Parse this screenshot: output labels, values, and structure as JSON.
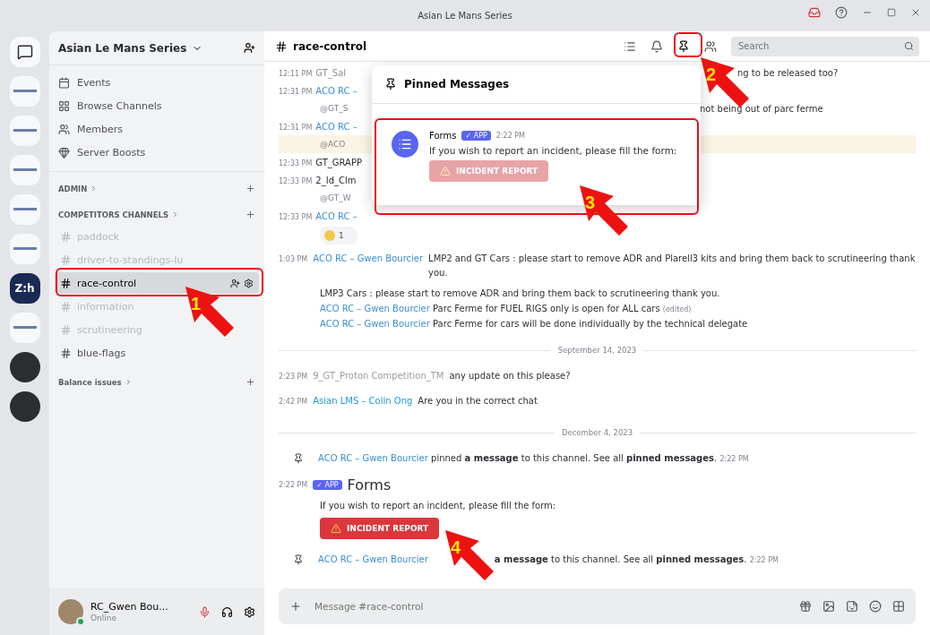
{
  "title_bar": {
    "title": "Asian Le Mans Series"
  },
  "servers": [
    {
      "kind": "home"
    },
    {
      "kind": "logo"
    },
    {
      "kind": "logo"
    },
    {
      "kind": "logo"
    },
    {
      "kind": "logo"
    },
    {
      "kind": "logo"
    },
    {
      "kind": "text",
      "label": "Z:h",
      "selected": true
    },
    {
      "kind": "logo"
    },
    {
      "kind": "round"
    },
    {
      "kind": "round"
    }
  ],
  "sidebar": {
    "server_name": "Asian Le Mans Series",
    "nav_items": [
      {
        "label": "Events"
      },
      {
        "label": "Browse Channels"
      },
      {
        "label": "Members"
      },
      {
        "label": "Server Boosts"
      }
    ],
    "categories": [
      {
        "name": "ADMIN"
      },
      {
        "name": "COMPETITORS CHANNELS",
        "channels": [
          {
            "name": "paddock",
            "muted": true,
            "selected": false
          },
          {
            "name": "driver-to-standings-lu",
            "muted": true,
            "selected": false
          },
          {
            "name": "race-control",
            "muted": false,
            "selected": true
          },
          {
            "name": "information",
            "muted": true,
            "selected": false
          },
          {
            "name": "scrutineering",
            "muted": true,
            "selected": false
          },
          {
            "name": "blue-flags",
            "muted": false,
            "selected": false
          }
        ]
      },
      {
        "name": "Balance issues"
      }
    ]
  },
  "user_panel": {
    "name": "RC_Gwen Bou...",
    "status": "Online"
  },
  "chat": {
    "channel": "race-control",
    "search": {
      "placeholder": "Search"
    },
    "messages": [
      {
        "kind": "partial",
        "time": "12:11 PM",
        "author": "GT_Sal",
        "color": "#8a8f96",
        "text": "ng to be released too?"
      },
      {
        "kind": "partial",
        "time": "12:31 PM",
        "author": "ACO RC – ",
        "color": "#3b8fd4"
      },
      {
        "kind": "reply",
        "author": "@GT_S",
        "text": "not being out of parc ferme"
      },
      {
        "kind": "partial",
        "time": "12:31 PM",
        "author": "ACO RC – ",
        "color": "#3b8fd4"
      },
      {
        "kind": "reply",
        "author": "@ACO",
        "mention": true
      },
      {
        "kind": "partial",
        "time": "12:33 PM",
        "author": "GT_GRAPP",
        "color": "#2b2d31"
      },
      {
        "kind": "partial",
        "time": "12:33 PM",
        "author": "2_Id_Clm",
        "color": "#2b2d31"
      },
      {
        "kind": "reply",
        "author": "@GT_W"
      },
      {
        "kind": "partial",
        "time": "12:33 PM",
        "author": "ACO RC – ",
        "color": "#3b8fd4"
      },
      {
        "kind": "reaction",
        "count": "1"
      },
      {
        "kind": "message",
        "time": "1:03 PM",
        "author": "ACO RC – Gwen Bourcier",
        "color": "#3b8fd4",
        "text": "LMP2 and GT Cars : please start to remove ADR and Plarell3 kits and bring them back to scrutineering thank you."
      },
      {
        "kind": "continuation",
        "text": "LMP3 Cars : please start to remove ADR and bring them back to scrutineering thank you."
      },
      {
        "kind": "inline",
        "author": "ACO RC – Gwen Bourcier",
        "color": "#3b8fd4",
        "text": "Parc Ferme for FUEL RIGS only is open for ALL cars",
        "suffix": "(edited)"
      },
      {
        "kind": "inline",
        "author": "ACO RC – Gwen Bourcier",
        "color": "#3b8fd4",
        "text": "Parc Ferme for cars will be done individually by the technical delegate"
      },
      {
        "kind": "divider",
        "text": "September 14, 2023"
      },
      {
        "kind": "message",
        "time": "2:23 PM",
        "author": "9_GT_Proton Competition_TM",
        "color": "#9a9ca0",
        "text": "any update on this please?"
      },
      {
        "kind": "message",
        "time": "2:42 PM",
        "author": "Asian LMS – Colin Ong",
        "color": "#1e9ad6",
        "text": "Are you in the correct chat"
      },
      {
        "kind": "divider",
        "text": "December 4, 2023"
      },
      {
        "kind": "pin",
        "author": "ACO RC – Gwen Bourcier",
        "color": "#3b8fd4",
        "text": "pinned **a message** to this channel. See all **pinned messages**.",
        "time": "2:22 PM"
      },
      {
        "kind": "bot",
        "time": "2:22 PM",
        "badge": "✓ APP",
        "author": "Forms",
        "color": "#2b2d31",
        "text": "If you wish to report an incident, please fill the form:",
        "button": "INCIDENT REPORT"
      },
      {
        "kind": "pin_covered",
        "author": "ACO RC – Gwen Bourcier",
        "color": "#3b8fd4",
        "text": "**a message** to this channel. See all **pinned messages**.",
        "time": "2:22 PM"
      }
    ],
    "composer": {
      "placeholder": "Message #race-control"
    }
  },
  "pinned_popup": {
    "title": "Pinned Messages",
    "items": [
      {
        "author": "Forms",
        "badge": "✓ APP",
        "time": "2:22 PM",
        "text": "If you wish to report an incident, please fill the form:",
        "button": "INCIDENT REPORT"
      }
    ]
  },
  "annotations": [
    {
      "number": "1"
    },
    {
      "number": "2"
    },
    {
      "number": "3"
    },
    {
      "number": "4"
    }
  ]
}
